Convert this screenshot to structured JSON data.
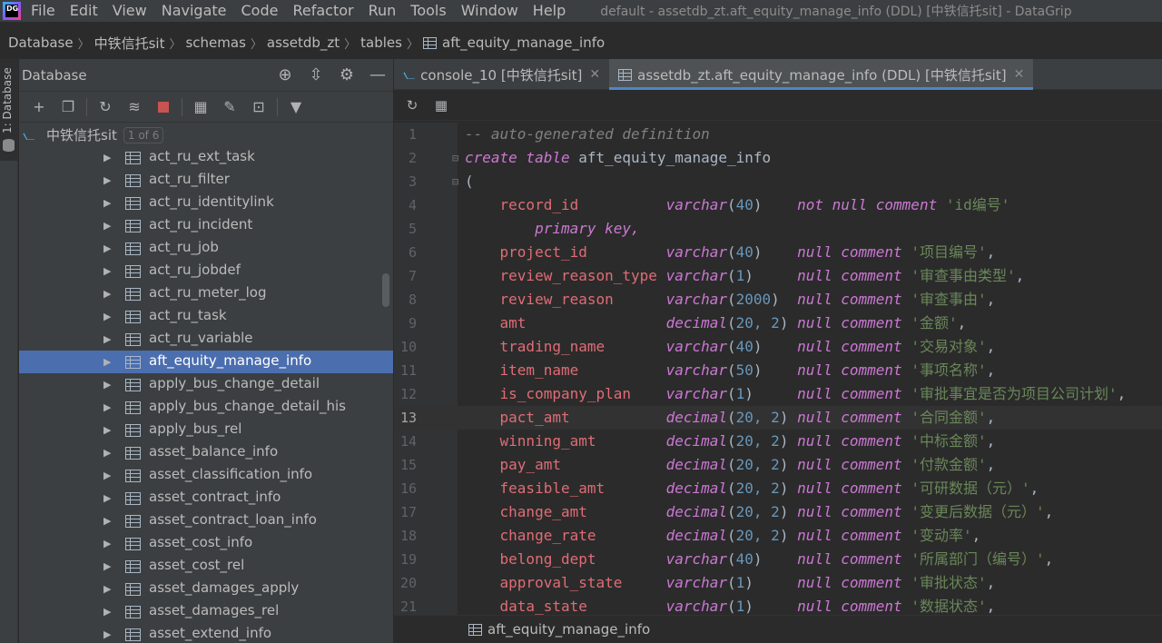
{
  "app": {
    "logo_text": "DG",
    "menu": [
      "File",
      "Edit",
      "View",
      "Navigate",
      "Code",
      "Refactor",
      "Run",
      "Tools",
      "Window",
      "Help"
    ],
    "title": "default - assetdb_zt.aft_equity_manage_info (DDL) [中铁信托sit] - DataGrip"
  },
  "breadcrumb": [
    "Database",
    "中铁信托sit",
    "schemas",
    "assetdb_zt",
    "tables",
    "aft_equity_manage_info"
  ],
  "left_strip": {
    "label": "1: Database"
  },
  "db_panel": {
    "title": "Database",
    "root": {
      "label": "中铁信托sit",
      "badge": "1 of 6"
    },
    "selected_index": 9,
    "tables": [
      "act_ru_ext_task",
      "act_ru_filter",
      "act_ru_identitylink",
      "act_ru_incident",
      "act_ru_job",
      "act_ru_jobdef",
      "act_ru_meter_log",
      "act_ru_task",
      "act_ru_variable",
      "aft_equity_manage_info",
      "apply_bus_change_detail",
      "apply_bus_change_detail_his",
      "apply_bus_rel",
      "asset_balance_info",
      "asset_classification_info",
      "asset_contract_info",
      "asset_contract_loan_info",
      "asset_cost_info",
      "asset_cost_rel",
      "asset_damages_apply",
      "asset_damages_rel",
      "asset_extend_info"
    ]
  },
  "tabs": [
    {
      "label": "console_10 [中铁信托sit]",
      "active": false
    },
    {
      "label": "assetdb_zt.aft_equity_manage_info (DDL) [中铁信托sit]",
      "active": true
    }
  ],
  "editor": {
    "current_line": 13,
    "comment": "-- auto-generated definition",
    "create_kw": "create table",
    "table_name": "aft_equity_manage_info",
    "open_paren": "(",
    "first_column": {
      "name": "record_id",
      "type": "varchar",
      "args": "40",
      "constraint": "not null comment",
      "comment": "'id编号'"
    },
    "primary_key": "primary key,",
    "columns": [
      {
        "name": "project_id",
        "type": "varchar",
        "args": "40",
        "comment": "'项目编号'"
      },
      {
        "name": "review_reason_type",
        "type": "varchar",
        "args": "1",
        "comment": "'审查事由类型'"
      },
      {
        "name": "review_reason",
        "type": "varchar",
        "args": "2000",
        "comment": "'审查事由'"
      },
      {
        "name": "amt",
        "type": "decimal",
        "args": "20, 2",
        "comment": "'金额'"
      },
      {
        "name": "trading_name",
        "type": "varchar",
        "args": "40",
        "comment": "'交易对象'"
      },
      {
        "name": "item_name",
        "type": "varchar",
        "args": "50",
        "comment": "'事项名称'"
      },
      {
        "name": "is_company_plan",
        "type": "varchar",
        "args": "1",
        "comment": "'审批事宜是否为项目公司计划'"
      },
      {
        "name": "pact_amt",
        "type": "decimal",
        "args": "20, 2",
        "comment": "'合同金额'"
      },
      {
        "name": "winning_amt",
        "type": "decimal",
        "args": "20, 2",
        "comment": "'中标金额'"
      },
      {
        "name": "pay_amt",
        "type": "decimal",
        "args": "20, 2",
        "comment": "'付款金额'"
      },
      {
        "name": "feasible_amt",
        "type": "decimal",
        "args": "20, 2",
        "comment": "'可研数据（元）'"
      },
      {
        "name": "change_amt",
        "type": "decimal",
        "args": "20, 2",
        "comment": "'变更后数据（元）'"
      },
      {
        "name": "change_rate",
        "type": "decimal",
        "args": "20, 2",
        "comment": "'变动率'"
      },
      {
        "name": "belong_dept",
        "type": "varchar",
        "args": "40",
        "comment": "'所属部门（编号）'"
      },
      {
        "name": "approval_state",
        "type": "varchar",
        "args": "1",
        "comment": "'审批状态'"
      },
      {
        "name": "data_state",
        "type": "varchar",
        "args": "1",
        "comment": "'数据状态'"
      }
    ],
    "null_comment": "null comment"
  },
  "status_bar": {
    "label": "aft_equity_manage_info"
  }
}
